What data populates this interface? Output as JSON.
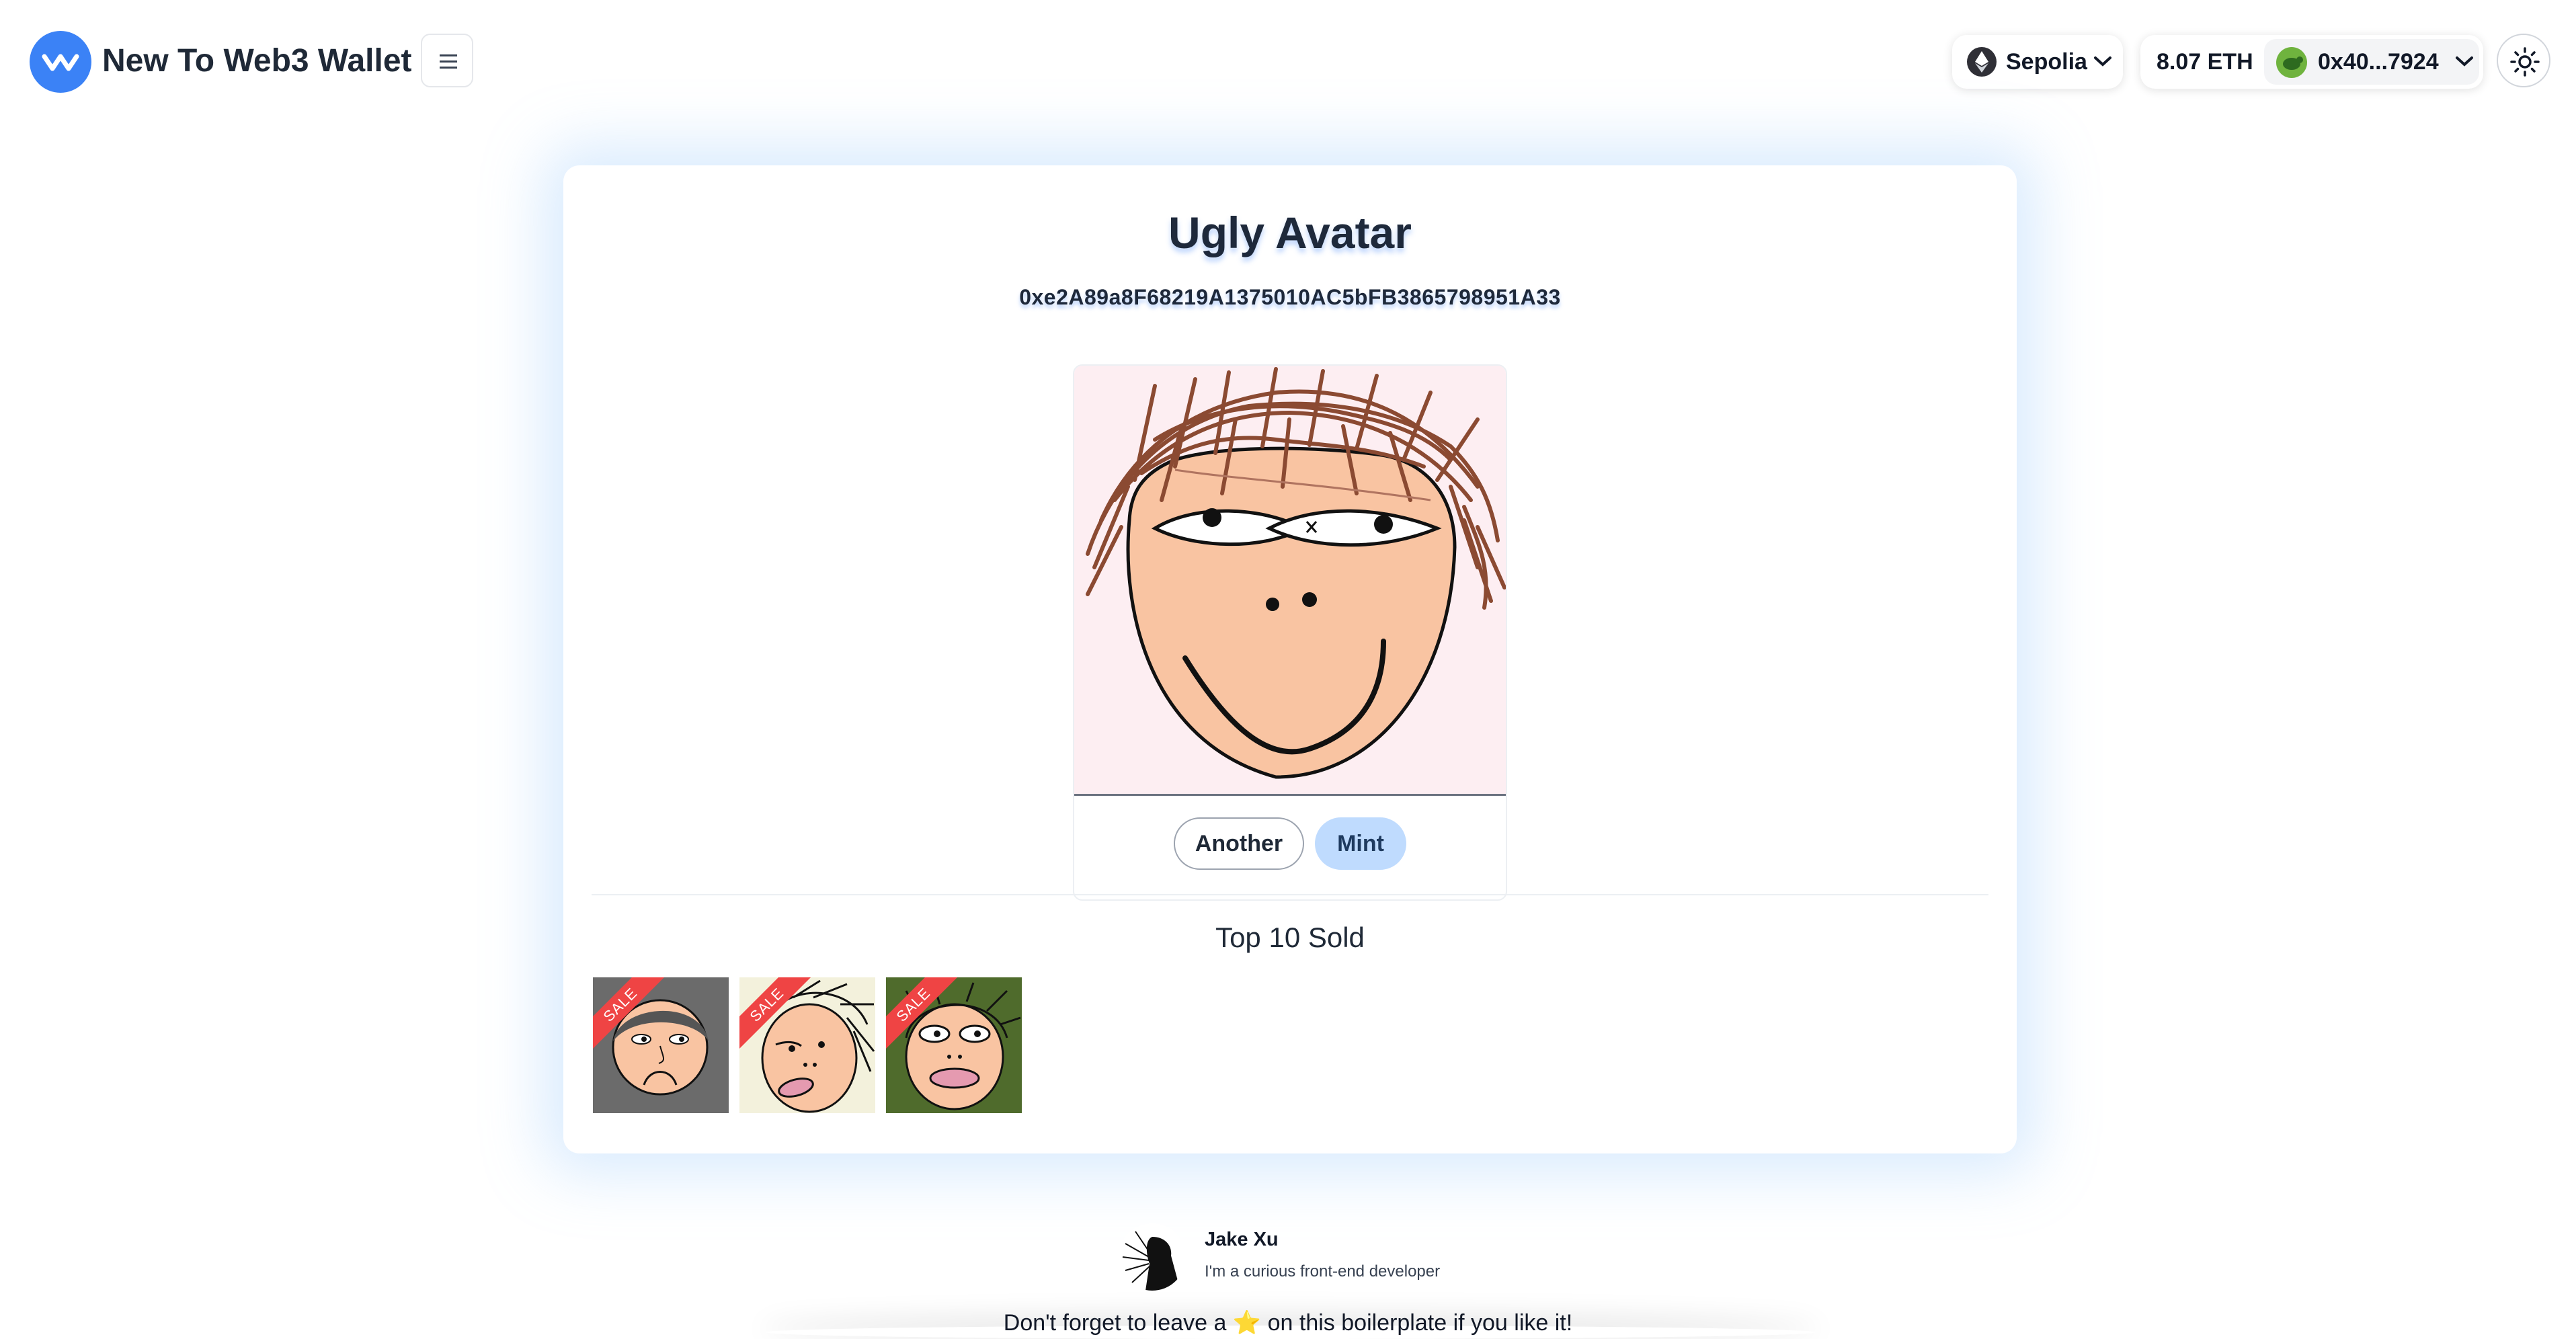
{
  "header": {
    "app_title": "New To Web3 Wallet",
    "logo_icon": "wave-logo-icon",
    "menu_icon": "hamburger-icon",
    "network": {
      "icon": "ethereum-icon",
      "label": "Sepolia"
    },
    "balance": "8.07 ETH",
    "account": {
      "address_short": "0x40...7924",
      "avatar_icon": "turtle-avatar-icon"
    },
    "theme_icon": "sun-icon"
  },
  "main": {
    "title": "Ugly Avatar",
    "contract_address": "0xe2A89a8F68219A1375010AC5bFB3865798951A33",
    "buttons": {
      "another": "Another",
      "mint": "Mint"
    },
    "top_sold_title": "Top 10 Sold",
    "sold_items": [
      {
        "badge": "SALE",
        "bg": "#6b6b6b"
      },
      {
        "badge": "SALE",
        "bg": "#f3f1dc"
      },
      {
        "badge": "SALE",
        "bg": "#4f6b2c"
      }
    ]
  },
  "footer": {
    "author_name": "Jake Xu",
    "author_bio": "I'm a curious front-end developer",
    "note_before": "Don't forget to leave a",
    "note_star": "⭐",
    "note_after": "on this boilerplate if you like it!"
  },
  "colors": {
    "accent": "#3b82f6",
    "mint_button": "#bfdbfe",
    "sale_ribbon": "#ef4444"
  }
}
